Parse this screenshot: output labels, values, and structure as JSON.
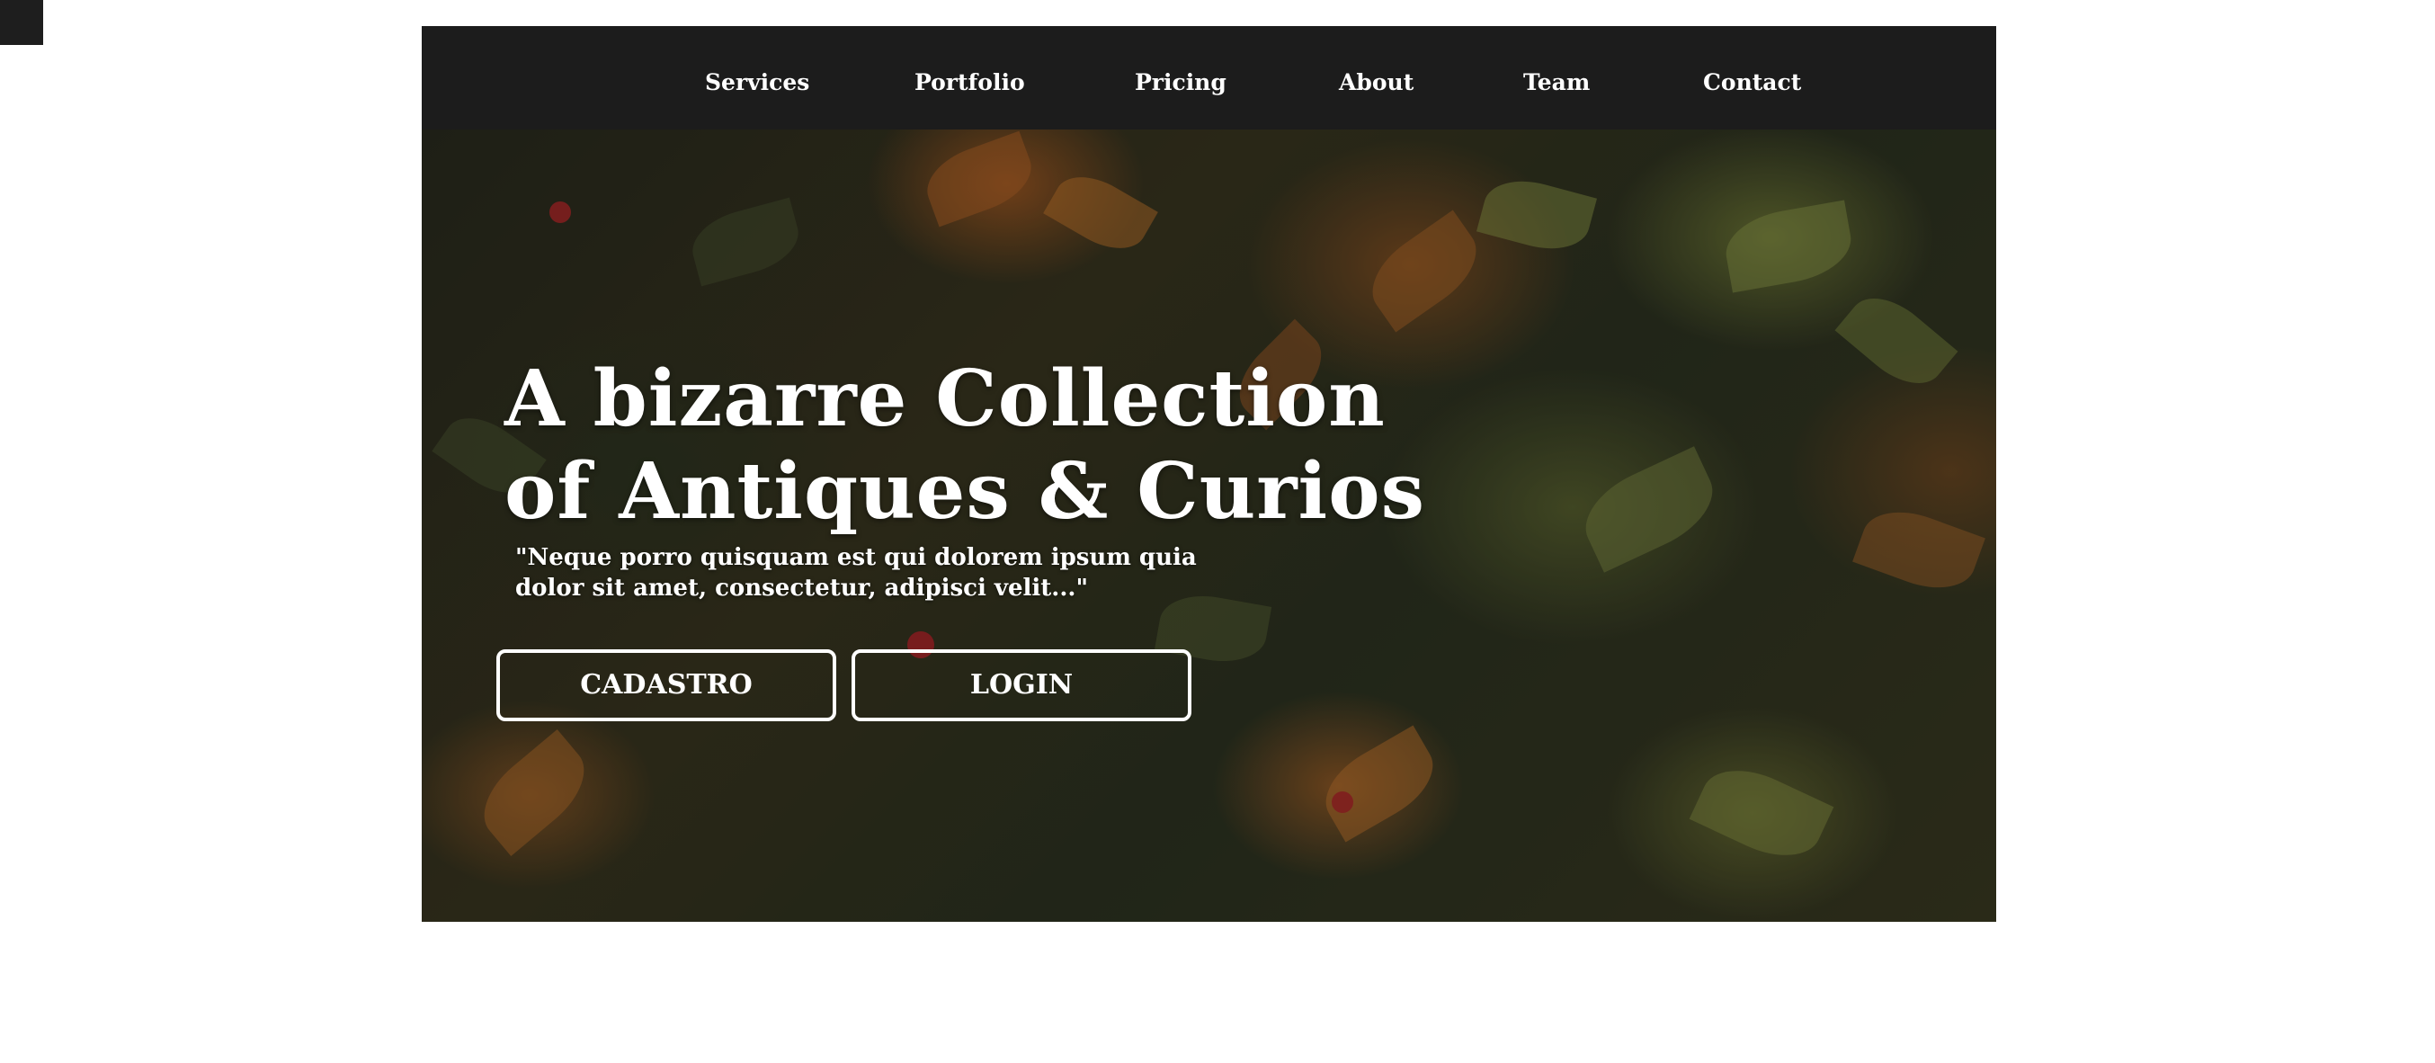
{
  "nav": {
    "items": [
      {
        "label": "Services"
      },
      {
        "label": "Portfolio"
      },
      {
        "label": "Pricing"
      },
      {
        "label": "About"
      },
      {
        "label": "Team"
      },
      {
        "label": "Contact"
      }
    ]
  },
  "hero": {
    "title_line1": "A bizarre Collection",
    "title_line2": "of Antiques & Curios",
    "quote_line1": "\"Neque porro quisquam est qui dolorem ipsum quia",
    "quote_line2": "dolor sit amet, consectetur, adipisci velit...\"",
    "buttons": {
      "signup_label": "CADASTRO",
      "login_label": "LOGIN"
    },
    "background": "autumn-leaves-photo"
  },
  "colors": {
    "navbar_bg": "#1c1c1c",
    "text": "#ffffff",
    "page_bg": "#ffffff"
  }
}
